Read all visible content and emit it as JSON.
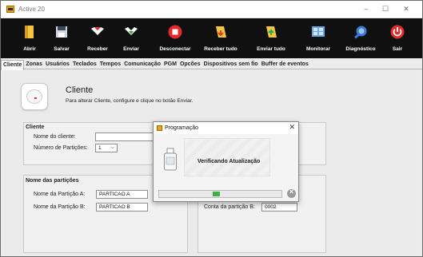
{
  "window": {
    "title": "Active 20",
    "minimize": "–",
    "maximize": "☐",
    "close": "✕"
  },
  "toolbar": [
    {
      "label": "Abrir",
      "icon": "open-file-icon"
    },
    {
      "label": "Salvar",
      "icon": "save-icon"
    },
    {
      "label": "Receber",
      "icon": "receive-icon"
    },
    {
      "label": "Enviar",
      "icon": "send-icon"
    },
    {
      "label": "Desconectar",
      "icon": "disconnect-icon"
    },
    {
      "label": "Receber tudo",
      "icon": "receive-all-icon"
    },
    {
      "label": "Enviar tudo",
      "icon": "send-all-icon"
    },
    {
      "label": "Monitorar",
      "icon": "monitor-icon"
    },
    {
      "label": "Diagnóstico",
      "icon": "diagnostic-icon"
    },
    {
      "label": "Sair",
      "icon": "power-icon"
    }
  ],
  "tabs": [
    "Cliente",
    "Zonas",
    "Usuários",
    "Teclados",
    "Tempos",
    "Comunicação",
    "PGM",
    "Opcões",
    "Dispositivos sem fio",
    "Buffer de eventos"
  ],
  "header": {
    "title": "Cliente",
    "subtitle": "Para alterar Cliente, configure e clique no botão Enviar."
  },
  "cliente_panel": {
    "title": "Cliente",
    "name_label": "Nome do cliente:",
    "name_value": "",
    "partitions_label": "Número de Partições:",
    "partitions_value": "1"
  },
  "partitions_panel": {
    "title": "Nome das partições",
    "a_label": "Nome da Partição A:",
    "a_value": "PARTICAO A",
    "b_label": "Nome da Partição B:",
    "b_value": "PARTICAO B"
  },
  "account_panel": {
    "b_label": "Conta da partição B:",
    "b_value": "0002"
  },
  "dialog": {
    "title": "Programação",
    "status": "Verificando Atualização",
    "progress_percent": 6,
    "progress_offset_percent": 44,
    "close": "✕"
  },
  "colors": {
    "toolbar_bg": "#101010",
    "progress": "#3cb04b",
    "app_icon": "#e8a317"
  }
}
